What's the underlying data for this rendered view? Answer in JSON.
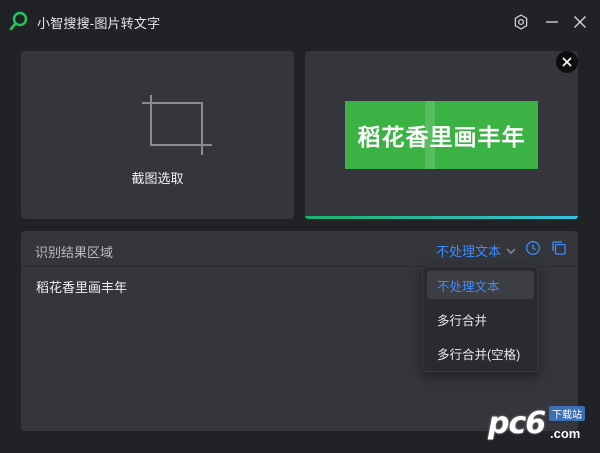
{
  "window": {
    "title": "小智搜搜-图片转文字"
  },
  "capture": {
    "label": "截图选取"
  },
  "preview": {
    "image_text": "稻花香里画丰年",
    "progress": 1.0
  },
  "result": {
    "title": "识别结果区域",
    "mode_selected": "不处理文本",
    "text": "稻花香里画丰年"
  },
  "dropdown": {
    "options": [
      "不处理文本",
      "多行合并",
      "多行合并(空格)"
    ],
    "selected_index": 0
  },
  "watermark": {
    "main": "pc6",
    "badge": "下载站",
    "suffix": ".com"
  },
  "colors": {
    "background": "#212226",
    "panel": "#35363b",
    "accent": "#3d8bff",
    "logo": "#22c55e",
    "preview_green": "#3bb244"
  },
  "icons": {
    "logo": "search-icon",
    "settings": "gear-icon",
    "minimize": "minimize-icon",
    "close": "close-icon",
    "crop": "crop-icon",
    "remove": "close-circle-icon",
    "chevron": "chevron-down-icon",
    "history": "clock-icon",
    "copy": "copy-icon"
  }
}
